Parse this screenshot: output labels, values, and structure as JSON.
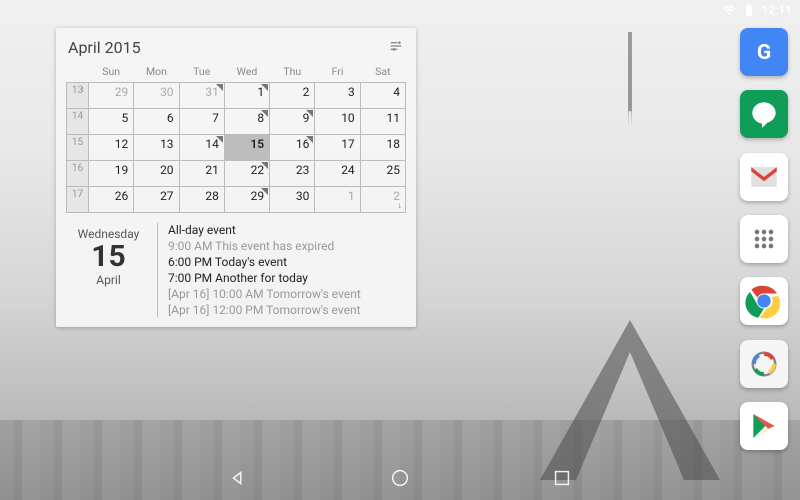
{
  "statusbar": {
    "time": "12:11"
  },
  "dock": {
    "apps": [
      {
        "name": "google",
        "label": "G"
      },
      {
        "name": "hangouts",
        "label": "“"
      },
      {
        "name": "gmail",
        "label": "M"
      },
      {
        "name": "appdrawer",
        "label": "⠿"
      },
      {
        "name": "chrome",
        "label": "◉"
      },
      {
        "name": "camera",
        "label": "◎"
      },
      {
        "name": "play",
        "label": "▶"
      }
    ]
  },
  "widget": {
    "title": "April 2015",
    "dow": [
      "Sun",
      "Mon",
      "Tue",
      "Wed",
      "Thu",
      "Fri",
      "Sat"
    ],
    "weeks": [
      {
        "wk": 13,
        "days": [
          {
            "d": 29,
            "other": true
          },
          {
            "d": 30,
            "other": true
          },
          {
            "d": 31,
            "other": true,
            "dot": true
          },
          {
            "d": 1,
            "dot": true
          },
          {
            "d": 2
          },
          {
            "d": 3
          },
          {
            "d": 4
          }
        ],
        "arrowUp": true
      },
      {
        "wk": 14,
        "days": [
          {
            "d": 5
          },
          {
            "d": 6
          },
          {
            "d": 7
          },
          {
            "d": 8,
            "dot": true
          },
          {
            "d": 9,
            "dot": true
          },
          {
            "d": 10
          },
          {
            "d": 11
          }
        ]
      },
      {
        "wk": 15,
        "days": [
          {
            "d": 12
          },
          {
            "d": 13
          },
          {
            "d": 14,
            "dot": true
          },
          {
            "d": 15,
            "today": true
          },
          {
            "d": 16,
            "dot": true
          },
          {
            "d": 17
          },
          {
            "d": 18
          }
        ]
      },
      {
        "wk": 16,
        "days": [
          {
            "d": 19
          },
          {
            "d": 20
          },
          {
            "d": 21
          },
          {
            "d": 22,
            "dot": true
          },
          {
            "d": 23
          },
          {
            "d": 24
          },
          {
            "d": 25
          }
        ]
      },
      {
        "wk": 17,
        "days": [
          {
            "d": 26
          },
          {
            "d": 27
          },
          {
            "d": 28
          },
          {
            "d": 29,
            "dot": true
          },
          {
            "d": 30
          },
          {
            "d": 1,
            "other": true
          },
          {
            "d": 2,
            "other": true
          }
        ],
        "arrowDown": true
      }
    ],
    "agenda": {
      "dow": "Wednesday",
      "dom": "15",
      "mon": "April",
      "events": [
        {
          "text": "All-day event",
          "dim": false
        },
        {
          "text": "9:00 AM This event has expired",
          "dim": true
        },
        {
          "text": "6:00 PM Today's event",
          "dim": false
        },
        {
          "text": "7:00 PM Another for today",
          "dim": false
        },
        {
          "text": "[Apr 16] 10:00 AM Tomorrow's event",
          "dim": true
        },
        {
          "text": "[Apr 16] 12:00 PM Tomorrow's event",
          "dim": true
        }
      ]
    }
  }
}
